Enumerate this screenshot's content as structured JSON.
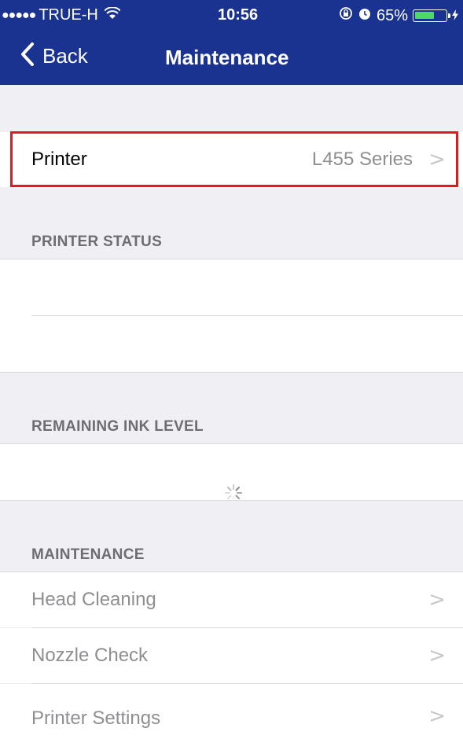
{
  "status_bar": {
    "signal_dots": "●●●●●",
    "carrier": "TRUE-H",
    "time": "10:56",
    "battery_percent": "65%",
    "battery_level": 0.65
  },
  "nav": {
    "back_label": "Back",
    "title": "Maintenance"
  },
  "printer_row": {
    "label": "Printer",
    "value": "L455 Series"
  },
  "sections": {
    "printer_status": "PRINTER STATUS",
    "remaining_ink": "REMAINING INK LEVEL",
    "maintenance": "MAINTENANCE"
  },
  "maintenance_items": [
    {
      "label": "Head Cleaning"
    },
    {
      "label": "Nozzle Check"
    },
    {
      "label": "Printer Settings"
    }
  ],
  "colors": {
    "nav_background": "#1a3391",
    "highlight_border": "#e01b1b"
  }
}
